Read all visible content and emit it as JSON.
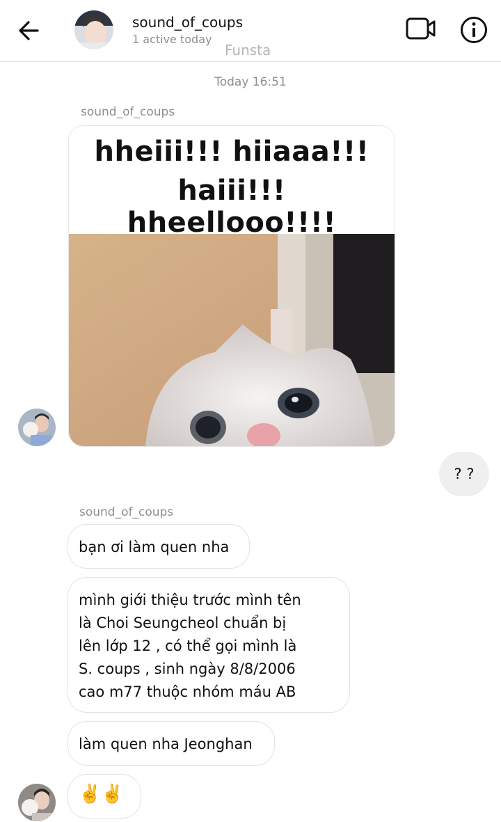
{
  "header": {
    "username": "sound_of_coups",
    "status": "1 active today",
    "subtitle": "Funsta",
    "icons": {
      "back": "arrow-left-icon",
      "video": "video-call-icon",
      "info": "info-icon"
    }
  },
  "thread": {
    "timestamp": "Today 16:51",
    "sender_name": "sound_of_coups",
    "image_message": {
      "caption_line1": "hheiii!!! hiiaaa!!!",
      "caption_line2": "haiii!!! hheellooo!!!!"
    },
    "outgoing": {
      "text": "? ?"
    },
    "incoming": [
      {
        "lines": [
          "bạn ơi làm quen nha"
        ]
      },
      {
        "lines": [
          "mình giới thiệu trước mình tên",
          "là Choi Seungcheol chuẩn bị",
          "lên lớp 12 , có thể gọi mình là",
          "S. coups , sinh ngày 8/8/2006",
          "cao m77 thuộc nhóm máu AB"
        ]
      },
      {
        "lines": [
          "làm quen nha Jeonghan"
        ]
      },
      {
        "lines": [
          "✌️✌️"
        ]
      }
    ]
  },
  "colors": {
    "bubble_out": "#efefef",
    "bubble_in_border": "#e2e2e2",
    "muted_text": "#8e8e8e"
  }
}
